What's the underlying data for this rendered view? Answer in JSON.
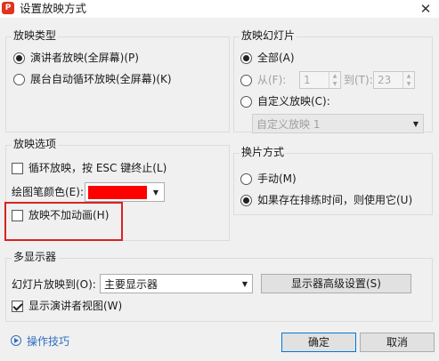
{
  "window": {
    "title": "设置放映方式",
    "close_glyph": "✕",
    "app_icon_letter": "P"
  },
  "show_type": {
    "legend": "放映类型",
    "options": [
      {
        "label": "演讲者放映(全屏幕)(P)",
        "selected": true
      },
      {
        "label": "展台自动循环放映(全屏幕)(K)",
        "selected": false
      }
    ]
  },
  "slides": {
    "legend": "放映幻灯片",
    "all_label": "全部(A)",
    "from_label": "从(F):",
    "from_value": "1",
    "to_label": "到(T):",
    "to_value": "23",
    "custom_label": "自定义放映(C):",
    "custom_combo_value": "自定义放映 1",
    "selected": "all"
  },
  "options": {
    "legend": "放映选项",
    "loop_label": "循环放映，按 ESC 键终止(L)",
    "loop_checked": false,
    "pen_color_label": "绘图笔颜色(E):",
    "pen_color": "#ff0000",
    "no_animation_label": "放映不加动画(H)",
    "no_animation_checked": false,
    "highlight_color": "#d92323"
  },
  "advance": {
    "legend": "换片方式",
    "manual_label": "手动(M)",
    "timing_label": "如果存在排练时间，则使用它(U)",
    "selected": "timing"
  },
  "multi_monitor": {
    "legend": "多显示器",
    "show_on_label": "幻灯片放映到(O):",
    "monitor_value": "主要显示器",
    "advanced_button": "显示器高级设置(S)",
    "presenter_view_label": "显示演讲者视图(W)",
    "presenter_view_checked": true
  },
  "footer": {
    "tips_label": "操作技巧",
    "ok_button": "确定",
    "cancel_button": "取消"
  },
  "icons": {
    "close": "close-icon",
    "dropdown": "chevron-down-icon",
    "spin_up": "spin-up-icon",
    "spin_down": "spin-down-icon",
    "tips": "play-circle-icon"
  },
  "colors": {
    "accent": "#0078d7",
    "tips_link": "#2f6fbf"
  }
}
